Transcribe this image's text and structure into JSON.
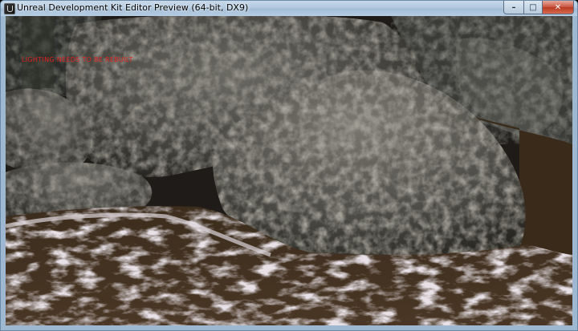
{
  "window": {
    "title": "Unreal Development Kit Editor Preview (64-bit, DX9)",
    "buttons": {
      "minimize": "–",
      "maximize": "□",
      "close": "✕"
    }
  },
  "viewport": {
    "warning_text": "LIGHTING NEEDS TO BE REBUILT",
    "warning_color": "#e02020"
  },
  "icons": [
    "udk-app-icon",
    "minimize-icon",
    "maximize-icon",
    "close-icon"
  ]
}
